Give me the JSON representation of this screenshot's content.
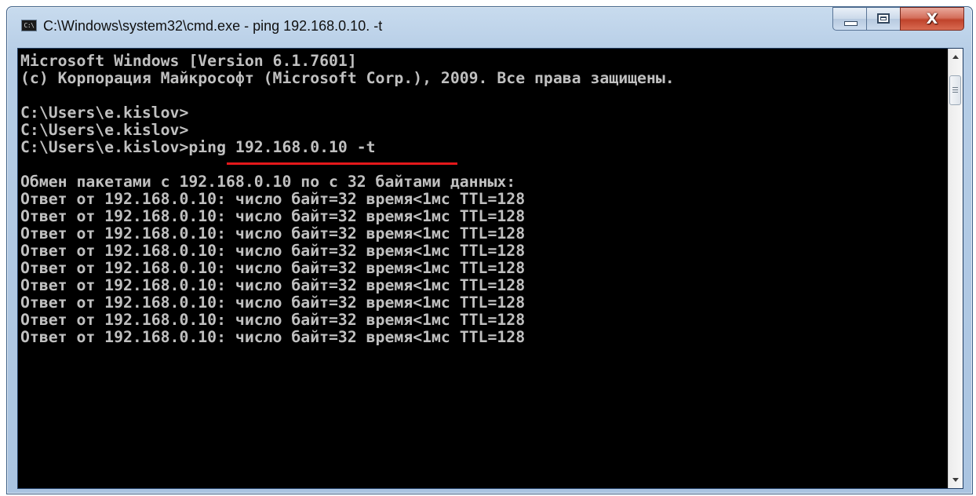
{
  "window": {
    "title": "C:\\Windows\\system32\\cmd.exe - ping  192.168.0.10. -t",
    "icon_text": "C:\\",
    "icon": "cmd-console-icon",
    "controls": {
      "minimize_icon": "minimize-icon",
      "maximize_icon": "maximize-icon",
      "close_glyph": "X",
      "close_color": "#c0432b"
    }
  },
  "console": {
    "background": "#000000",
    "text_color": "#c0c0c0",
    "highlight_color": "#e4181b",
    "lines": [
      "Microsoft Windows [Version 6.1.7601]",
      "(c) Корпорация Майкрософт (Microsoft Corp.), 2009. Все права защищены.",
      "",
      "C:\\Users\\e.kislov>",
      "C:\\Users\\e.kislov>",
      "C:\\Users\\e.kislov>ping 192.168.0.10 -t",
      "",
      "Обмен пакетами с 192.168.0.10 по с 32 байтами данных:",
      "Ответ от 192.168.0.10: число байт=32 время<1мс TTL=128",
      "Ответ от 192.168.0.10: число байт=32 время<1мс TTL=128",
      "Ответ от 192.168.0.10: число байт=32 время<1мс TTL=128",
      "Ответ от 192.168.0.10: число байт=32 время<1мс TTL=128",
      "Ответ от 192.168.0.10: число байт=32 время<1мс TTL=128",
      "Ответ от 192.168.0.10: число байт=32 время<1мс TTL=128",
      "Ответ от 192.168.0.10: число байт=32 время<1мс TTL=128",
      "Ответ от 192.168.0.10: число байт=32 время<1мс TTL=128",
      "Ответ от 192.168.0.10: число байт=32 время<1мс TTL=128"
    ]
  },
  "scrollbar": {
    "up_icon": "scroll-up-arrow-icon",
    "down_icon": "scroll-down-arrow-icon"
  }
}
